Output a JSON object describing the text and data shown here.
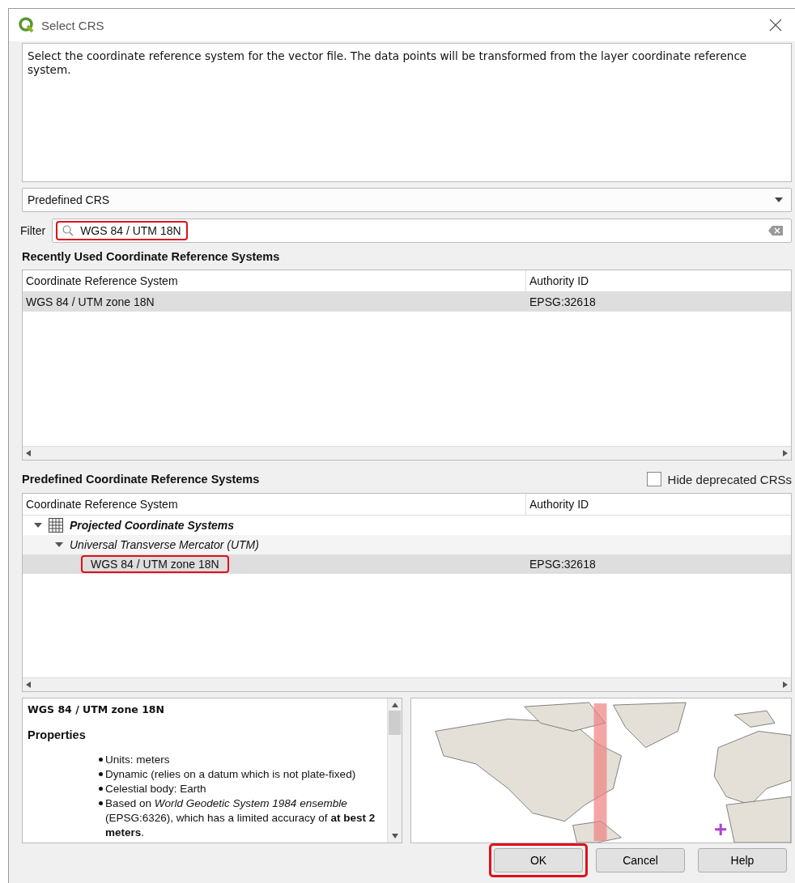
{
  "window": {
    "title": "Select CRS"
  },
  "description": "Select the coordinate reference system for the vector file. The data points will be transformed from the layer coordinate reference system.",
  "crs_type": {
    "value": "Predefined CRS"
  },
  "filter": {
    "label": "Filter",
    "value": "WGS 84 / UTM 18N",
    "highlighted": true
  },
  "recent": {
    "heading": "Recently Used Coordinate Reference Systems",
    "columns": [
      "Coordinate Reference System",
      "Authority ID"
    ],
    "rows": [
      {
        "name": "WGS 84 / UTM zone 18N",
        "authority_id": "EPSG:32618",
        "selected": true
      }
    ]
  },
  "predefined": {
    "heading": "Predefined Coordinate Reference Systems",
    "hide_deprecated": {
      "label": "Hide deprecated CRSs",
      "checked": false
    },
    "columns": [
      "Coordinate Reference System",
      "Authority ID"
    ],
    "tree": [
      {
        "name": "Projected Coordinate Systems",
        "expanded": true,
        "selected": false,
        "children": [
          {
            "name": "Universal Transverse Mercator (UTM)",
            "expanded": true,
            "selected": false,
            "children": [
              {
                "name": "WGS 84 / UTM zone 18N",
                "authority_id": "EPSG:32618",
                "selected": true,
                "highlighted": true
              }
            ]
          }
        ]
      }
    ]
  },
  "details": {
    "title": "WGS 84 / UTM zone 18N",
    "section": "Properties",
    "items": [
      "Units: meters",
      "Dynamic (relies on a datum which is not plate-fixed)",
      "Celestial body: Earth",
      "Based on *World Geodetic System 1984 ensemble* (EPSG:6326), which has a limited accuracy of **at best 2 meters**."
    ]
  },
  "buttons": [
    {
      "label": "OK",
      "highlighted": true
    },
    {
      "label": "Cancel",
      "highlighted": false
    },
    {
      "label": "Help",
      "highlighted": false
    }
  ]
}
